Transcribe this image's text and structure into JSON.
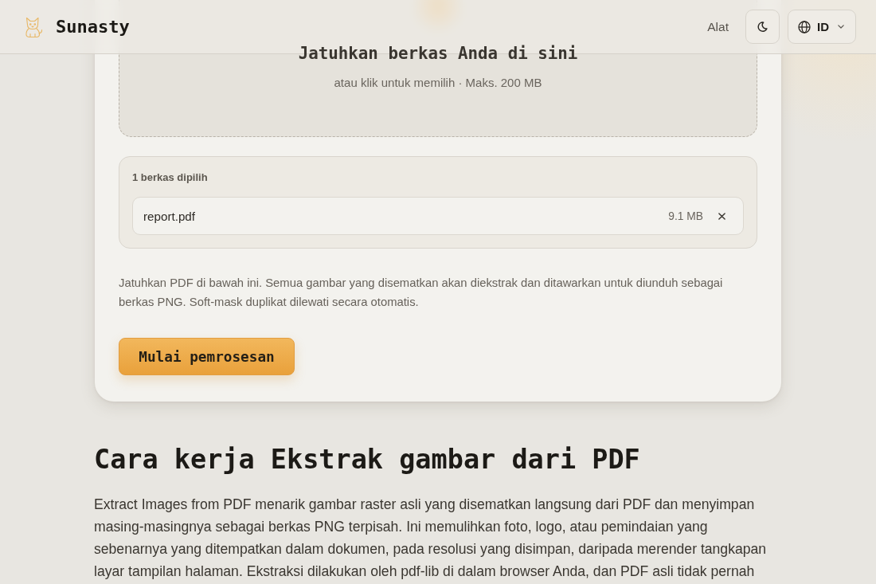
{
  "header": {
    "brand": "Sunasty",
    "nav": [
      {
        "label": "Alat"
      }
    ],
    "language": {
      "label": "ID"
    }
  },
  "dropzone": {
    "title": "Jatuhkan berkas Anda di sini",
    "hint": "atau klik untuk memilih · Maks. 200 MB"
  },
  "selected_files": {
    "label": "1 berkas dipilih",
    "files": [
      {
        "name": "report.pdf",
        "size": "9.1 MB"
      }
    ]
  },
  "description": "Jatuhkan PDF di bawah ini. Semua gambar yang disematkan akan diekstrak dan ditawarkan untuk diunduh sebagai berkas PNG. Soft-mask duplikat dilewati secara otomatis.",
  "start_button": "Mulai pemrosesan",
  "how_it_works": {
    "title": "Cara kerja Ekstrak gambar dari PDF",
    "body": "Extract Images from PDF menarik gambar raster asli yang disematkan langsung dari PDF dan menyimpan masing-masingnya sebagai berkas PNG terpisah. Ini memulihkan foto, logo, atau pemindaian yang sebenarnya yang ditempatkan dalam dokumen, pada resolusi yang disimpan, daripada merender tangkapan layar tampilan halaman. Ekstraksi dilakukan oleh pdf-lib di dalam browser Anda, dan PDF asli tidak pernah"
  }
}
